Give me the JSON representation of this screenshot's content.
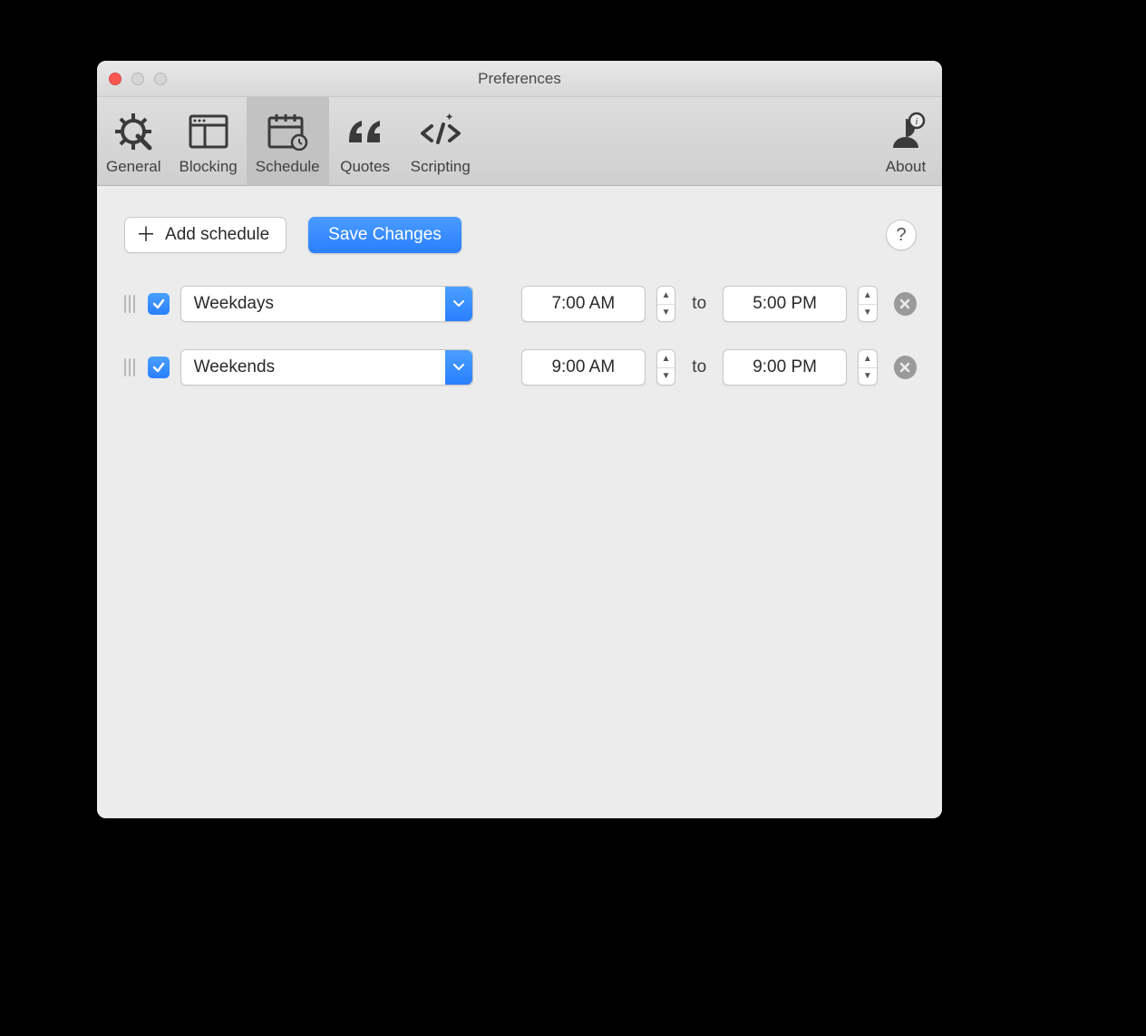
{
  "window": {
    "title": "Preferences"
  },
  "toolbar": {
    "tabs": [
      {
        "label": "General",
        "icon": "gear"
      },
      {
        "label": "Blocking",
        "icon": "layout"
      },
      {
        "label": "Schedule",
        "icon": "calendar"
      },
      {
        "label": "Quotes",
        "icon": "quotes"
      },
      {
        "label": "Scripting",
        "icon": "code"
      }
    ],
    "about_label": "About",
    "active_index": 2
  },
  "buttons": {
    "add_schedule": "Add schedule",
    "save_changes": "Save Changes",
    "help": "?"
  },
  "schedules": [
    {
      "enabled": true,
      "day_type": "Weekdays",
      "start": "7:00 AM",
      "to": "to",
      "end": "5:00 PM"
    },
    {
      "enabled": true,
      "day_type": "Weekends",
      "start": "9:00 AM",
      "to": "to",
      "end": "9:00 PM"
    }
  ]
}
